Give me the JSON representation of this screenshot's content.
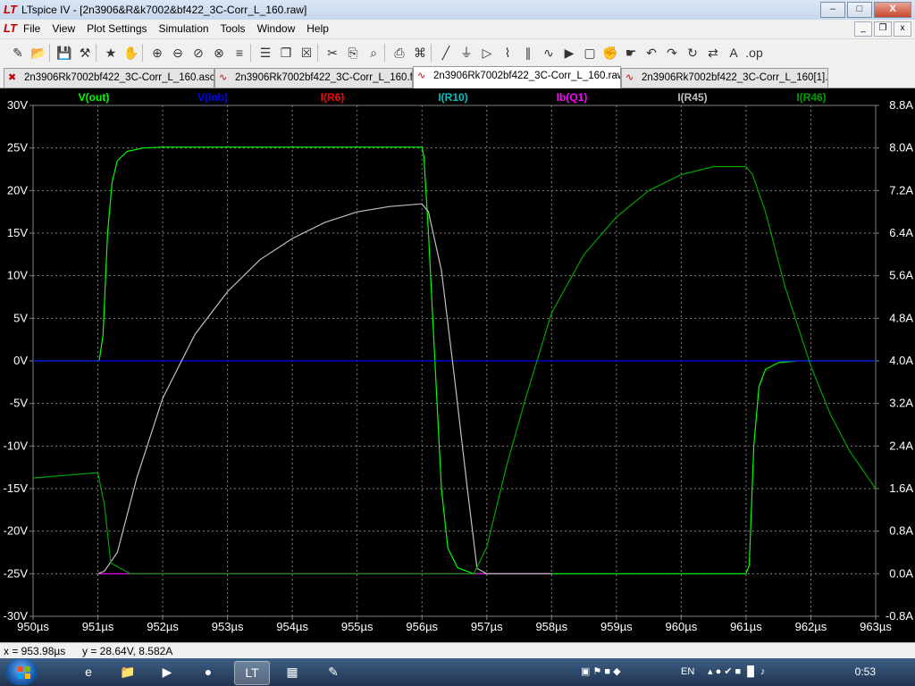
{
  "window": {
    "title": "LTspice IV - [2n3906&R&k7002&bf422_3C-Corr_L_160.raw]",
    "app_icon": "ltspice-logo-icon",
    "controls": {
      "minimize": "–",
      "maximize": "□",
      "close": "X"
    }
  },
  "menu": {
    "items": [
      "File",
      "View",
      "Plot Settings",
      "Simulation",
      "Tools",
      "Window",
      "Help"
    ],
    "mdi_controls": {
      "minimize": "_",
      "restore": "❐",
      "close": "x"
    }
  },
  "toolbar": {
    "icons": [
      "new-schematic-icon",
      "open-icon",
      "save-icon",
      "control-panel-icon",
      "run-icon",
      "halt-icon",
      "zoom-in-icon",
      "zoom-out-icon",
      "zoom-fit-icon",
      "zoom-cancel-icon",
      "autorange-icon",
      "tile-horizontal-icon",
      "cascade-icon",
      "close-all-icon",
      "cut-icon",
      "copy-icon",
      "find-icon",
      "print-icon",
      "print-setup-icon",
      "wire-icon",
      "ground-icon",
      "label-icon",
      "resistor-icon",
      "capacitor-icon",
      "inductor-icon",
      "diode-icon",
      "component-icon",
      "move-icon",
      "drag-icon",
      "undo-icon",
      "redo-icon",
      "rotate-icon",
      "mirror-icon",
      "text-icon",
      "spice-directive-icon"
    ]
  },
  "tabs": [
    {
      "label": "2n3906Rk7002bf422_3C-Corr_L_160.asc",
      "icon": "schematic-icon",
      "active": false
    },
    {
      "label": "2n3906Rk7002bf422_3C-Corr_L_160.fft",
      "icon": "waveform-icon",
      "active": false
    },
    {
      "label": "2n3906Rk7002bf422_3C-Corr_L_160.raw",
      "icon": "waveform-icon",
      "active": true
    },
    {
      "label": "2n3906Rk7002bf422_3C-Corr_L_160[1].fft",
      "icon": "waveform-icon",
      "active": false
    }
  ],
  "chart_data": {
    "type": "line",
    "background": "#000000",
    "grid": true,
    "xlabel": "",
    "x_ticks": [
      "950µs",
      "951µs",
      "952µs",
      "953µs",
      "954µs",
      "955µs",
      "956µs",
      "957µs",
      "958µs",
      "959µs",
      "960µs",
      "961µs",
      "962µs",
      "963µs"
    ],
    "xlim": [
      950,
      963
    ],
    "y_left_ticks": [
      "30V",
      "25V",
      "20V",
      "15V",
      "10V",
      "5V",
      "0V",
      "-5V",
      "-10V",
      "-15V",
      "-20V",
      "-25V",
      "-30V"
    ],
    "ylim_left": [
      -30,
      30
    ],
    "y_right_ticks": [
      "8.8A",
      "8.0A",
      "7.2A",
      "6.4A",
      "5.6A",
      "4.8A",
      "4.0A",
      "3.2A",
      "2.4A",
      "1.6A",
      "0.8A",
      "0.0A",
      "-0.8A"
    ],
    "ylim_right": [
      -0.8,
      8.8
    ],
    "legend_position": "top",
    "series": [
      {
        "name": "V(out)",
        "color": "#00ff00",
        "axis": "left",
        "points": [
          [
            950,
            0
          ],
          [
            951.02,
            0
          ],
          [
            951.08,
            3
          ],
          [
            951.15,
            15
          ],
          [
            951.22,
            21
          ],
          [
            951.3,
            23.5
          ],
          [
            951.45,
            24.6
          ],
          [
            951.7,
            25
          ],
          [
            952,
            25.1
          ],
          [
            956,
            25.1
          ],
          [
            956.03,
            24
          ],
          [
            956.1,
            15
          ],
          [
            956.2,
            0
          ],
          [
            956.3,
            -15
          ],
          [
            956.4,
            -22
          ],
          [
            956.55,
            -24.3
          ],
          [
            956.8,
            -25
          ],
          [
            961,
            -25
          ],
          [
            961.05,
            -24
          ],
          [
            961.12,
            -10
          ],
          [
            961.2,
            -3
          ],
          [
            961.3,
            -1
          ],
          [
            961.5,
            -0.2
          ],
          [
            961.8,
            0
          ],
          [
            963,
            0
          ]
        ]
      },
      {
        "name": "V(inb)",
        "color": "#0000ff",
        "axis": "left",
        "points": [
          [
            950,
            0
          ],
          [
            963,
            0
          ]
        ]
      },
      {
        "name": "I(R6)",
        "color": "#ff0000",
        "axis": "left",
        "points": []
      },
      {
        "name": "I(R10)",
        "color": "#00c0c0",
        "axis": "left",
        "points": []
      },
      {
        "name": "Ib(Q1)",
        "color": "#ff00ff",
        "axis": "right",
        "points": [
          [
            951,
            0
          ],
          [
            952,
            0
          ],
          [
            956.8,
            0
          ],
          [
            958,
            0
          ]
        ]
      },
      {
        "name": "I(R45)",
        "color": "#c0c0c0",
        "axis": "right",
        "points": [
          [
            951,
            0
          ],
          [
            951.1,
            0.05
          ],
          [
            951.3,
            0.4
          ],
          [
            951.6,
            1.8
          ],
          [
            952,
            3.3
          ],
          [
            952.5,
            4.5
          ],
          [
            953,
            5.3
          ],
          [
            953.5,
            5.9
          ],
          [
            954,
            6.3
          ],
          [
            954.5,
            6.6
          ],
          [
            955,
            6.8
          ],
          [
            955.5,
            6.9
          ],
          [
            956,
            6.95
          ],
          [
            956.1,
            6.8
          ],
          [
            956.3,
            5.7
          ],
          [
            956.5,
            3.7
          ],
          [
            956.7,
            1.6
          ],
          [
            956.85,
            0.1
          ],
          [
            957,
            0
          ],
          [
            958,
            0
          ]
        ]
      },
      {
        "name": "I(R46)",
        "color": "#00a000",
        "axis": "right",
        "points": [
          [
            950,
            1.8
          ],
          [
            951,
            1.9
          ],
          [
            951.1,
            1.3
          ],
          [
            951.2,
            0.2
          ],
          [
            951.5,
            0
          ],
          [
            956.8,
            0
          ],
          [
            957,
            0.5
          ],
          [
            957.3,
            2.0
          ],
          [
            957.6,
            3.3
          ],
          [
            958,
            4.9
          ],
          [
            958.5,
            6.0
          ],
          [
            959,
            6.7
          ],
          [
            959.5,
            7.2
          ],
          [
            960,
            7.5
          ],
          [
            960.5,
            7.65
          ],
          [
            961,
            7.65
          ],
          [
            961.1,
            7.5
          ],
          [
            961.3,
            6.8
          ],
          [
            961.6,
            5.4
          ],
          [
            962,
            3.9
          ],
          [
            962.3,
            3.0
          ],
          [
            962.6,
            2.3
          ],
          [
            963,
            1.6
          ]
        ]
      }
    ]
  },
  "status": {
    "x_readout": "x = 953.98µs",
    "y_readout": "y = 28.64V, 8.582A"
  },
  "taskbar": {
    "apps": [
      "start-orb-icon",
      "ie-icon",
      "explorer-icon",
      "media-player-icon",
      "firefox-icon",
      "ltspice-icon",
      "calculator-icon",
      "paint-icon"
    ],
    "language": "EN",
    "clock": "0:53"
  }
}
